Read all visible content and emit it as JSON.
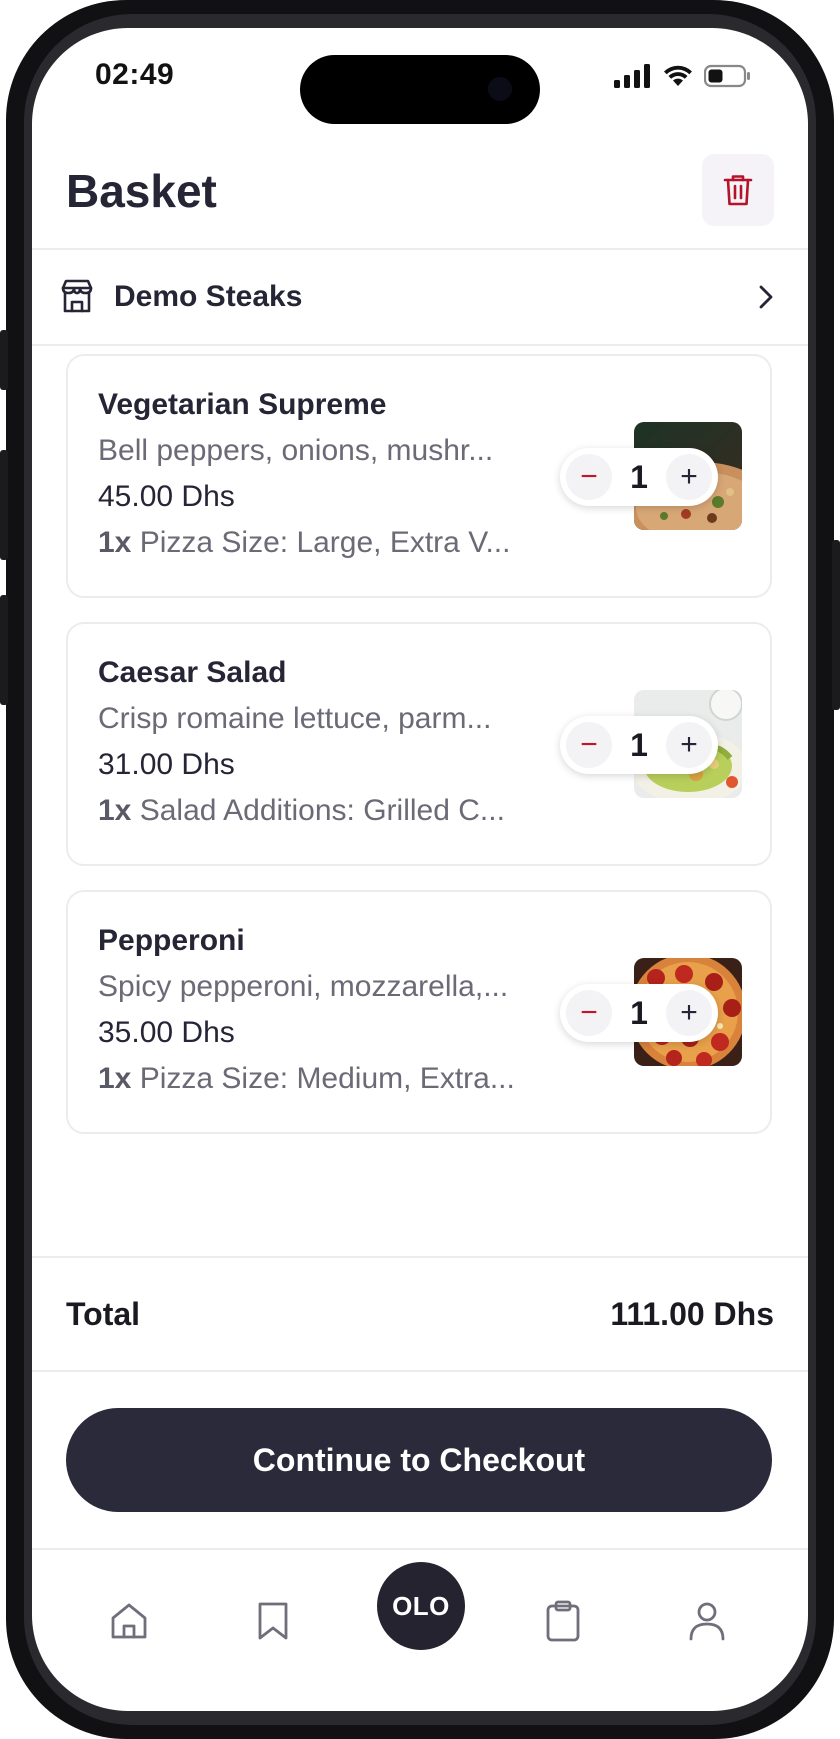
{
  "status_bar": {
    "time": "02:49"
  },
  "header": {
    "title": "Basket"
  },
  "restaurant": {
    "name": "Demo Steaks"
  },
  "items": [
    {
      "name": "Vegetarian Supreme",
      "description": "Bell peppers, onions, mushr...",
      "price": "45.00 Dhs",
      "modifier_qty": "1x",
      "modifier_text": "Pizza Size: Large, Extra V...",
      "quantity": "1"
    },
    {
      "name": "Caesar Salad",
      "description": "Crisp romaine lettuce, parm...",
      "price": "31.00 Dhs",
      "modifier_qty": "1x",
      "modifier_text": "Salad Additions: Grilled C...",
      "quantity": "1"
    },
    {
      "name": "Pepperoni",
      "description": "Spicy pepperoni, mozzarella,...",
      "price": "35.00 Dhs",
      "modifier_qty": "1x",
      "modifier_text": "Pizza Size: Medium, Extra...",
      "quantity": "1"
    }
  ],
  "stepper": {
    "minus": "−",
    "plus": "+"
  },
  "total": {
    "label": "Total",
    "value": "111.00 Dhs"
  },
  "checkout": {
    "label": "Continue to Checkout"
  },
  "bottom_nav": {
    "items": [
      "home-icon",
      "bookmark-icon",
      "olo-logo",
      "clipboard-icon",
      "user-icon"
    ],
    "center_label": "OLO"
  },
  "colors": {
    "primary_dark": "#2b2a3b",
    "accent_red": "#c0162c",
    "text_primary": "#262535",
    "text_secondary": "#6b6a76"
  }
}
